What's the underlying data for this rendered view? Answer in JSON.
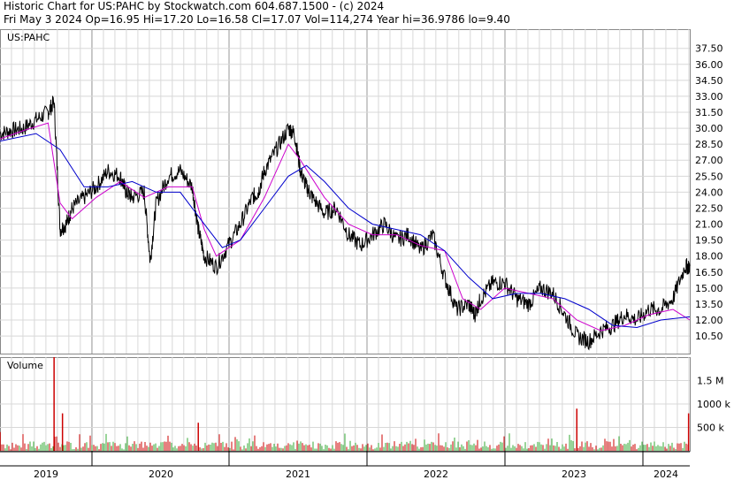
{
  "header": {
    "line1": "Historic Chart for US:PAHC by Stockwatch.com 604.687.1500 - (c) 2024",
    "line2": "Fri May  3 2024   Op=16.95  Hi=17.20  Lo=16.58  Cl=17.07  Vol=114,274  Year hi=36.9786  lo=9.40"
  },
  "chart_data": {
    "type": "line",
    "symbol_label": "US:PAHC",
    "price_ticks": [
      "37.50",
      "36.00",
      "34.50",
      "33.00",
      "31.50",
      "30.00",
      "28.50",
      "27.00",
      "25.50",
      "24.00",
      "22.50",
      "21.00",
      "19.50",
      "18.00",
      "16.50",
      "15.00",
      "13.50",
      "12.00",
      "10.50"
    ],
    "price_tick_values": [
      37.5,
      36.0,
      34.5,
      33.0,
      31.5,
      30.0,
      28.5,
      27.0,
      25.5,
      24.0,
      22.5,
      21.0,
      19.5,
      18.0,
      16.5,
      15.0,
      13.5,
      12.0,
      10.5
    ],
    "ylim": [
      8.85,
      39.3
    ],
    "volume_label": "Volume",
    "volume_ticks": [
      "1.5 M",
      "1000 k",
      "500 k"
    ],
    "volume_tick_values": [
      1500000,
      1000000,
      500000
    ],
    "volume_max": 2000000,
    "year_labels": [
      "2019",
      "2020",
      "2021",
      "2022",
      "2023",
      "2024"
    ],
    "series": [
      {
        "name": "price",
        "color": "#000000",
        "x": [
          2018.6,
          2018.7,
          2018.8,
          2018.9,
          2019.0,
          2019.05,
          2019.1,
          2019.15,
          2019.2,
          2019.3,
          2019.4,
          2019.5,
          2019.6,
          2019.65,
          2019.7,
          2019.8,
          2019.85,
          2019.9,
          2020.0,
          2020.1,
          2020.2,
          2020.25,
          2020.3,
          2020.4,
          2020.5,
          2020.6,
          2020.7,
          2020.75,
          2020.8,
          2020.9,
          2021.0,
          2021.05,
          2021.1,
          2021.15,
          2021.2,
          2021.3,
          2021.4,
          2021.5,
          2021.6,
          2021.7,
          2021.8,
          2021.9,
          2022.0,
          2022.1,
          2022.2,
          2022.3,
          2022.4,
          2022.5,
          2022.55,
          2022.6,
          2022.7,
          2022.8,
          2022.9,
          2023.0,
          2023.1,
          2023.2,
          2023.3,
          2023.4,
          2023.5,
          2023.6,
          2023.7,
          2023.8,
          2023.9,
          2024.0,
          2024.1,
          2024.2,
          2024.3,
          2024.34
        ],
        "y": [
          29.5,
          29.8,
          30.0,
          30.8,
          31.5,
          32.5,
          20.5,
          21.0,
          22.5,
          23.5,
          24.5,
          26.0,
          25.5,
          24.0,
          23.5,
          24.0,
          17.5,
          23.0,
          25.5,
          26.0,
          24.5,
          20.5,
          18.0,
          17.0,
          19.0,
          21.0,
          23.5,
          24.0,
          26.0,
          28.0,
          30.0,
          29.5,
          26.0,
          24.5,
          23.5,
          22.0,
          22.5,
          20.0,
          19.0,
          20.0,
          21.0,
          19.5,
          20.0,
          18.5,
          20.0,
          16.0,
          13.0,
          13.5,
          12.5,
          14.0,
          15.5,
          15.5,
          14.0,
          13.5,
          15.0,
          14.5,
          12.5,
          10.5,
          10.0,
          11.0,
          11.5,
          12.5,
          12.0,
          13.0,
          13.0,
          14.0,
          17.0,
          17.07
        ]
      },
      {
        "name": "short moving average",
        "color": "#cc00cc",
        "x": [
          2018.6,
          2018.8,
          2019.0,
          2019.1,
          2019.2,
          2019.4,
          2019.6,
          2019.8,
          2020.0,
          2020.2,
          2020.3,
          2020.4,
          2020.6,
          2020.8,
          2021.0,
          2021.1,
          2021.3,
          2021.5,
          2021.7,
          2021.9,
          2022.1,
          2022.3,
          2022.45,
          2022.6,
          2022.8,
          2023.0,
          2023.2,
          2023.4,
          2023.6,
          2023.8,
          2024.0,
          2024.2,
          2024.34
        ],
        "y": [
          29.0,
          29.8,
          30.5,
          23.0,
          21.5,
          23.5,
          25.0,
          23.5,
          24.5,
          24.5,
          20.5,
          18.0,
          19.5,
          23.5,
          28.5,
          27.0,
          23.5,
          21.0,
          20.0,
          20.0,
          19.0,
          18.5,
          14.0,
          13.0,
          15.0,
          14.5,
          14.0,
          12.0,
          11.0,
          11.5,
          12.5,
          13.0,
          12.0
        ]
      },
      {
        "name": "long moving average",
        "color": "#0000cc",
        "x": [
          2018.6,
          2018.9,
          2019.1,
          2019.3,
          2019.5,
          2019.7,
          2019.9,
          2020.1,
          2020.3,
          2020.45,
          2020.6,
          2020.8,
          2021.0,
          2021.15,
          2021.3,
          2021.5,
          2021.7,
          2021.9,
          2022.1,
          2022.3,
          2022.5,
          2022.7,
          2022.9,
          2023.1,
          2023.3,
          2023.5,
          2023.7,
          2023.9,
          2024.1,
          2024.34
        ],
        "y": [
          28.8,
          29.5,
          28.0,
          24.5,
          24.5,
          25.0,
          24.0,
          24.0,
          21.0,
          18.8,
          19.5,
          22.5,
          25.5,
          26.5,
          25.0,
          22.5,
          21.0,
          20.5,
          20.0,
          18.5,
          16.0,
          14.0,
          14.5,
          14.5,
          14.0,
          13.0,
          11.5,
          11.3,
          12.0,
          12.3
        ]
      }
    ],
    "volume": {
      "baseline_range_k": [
        30,
        250
      ],
      "spikes": [
        {
          "x": 2018.6,
          "value": 400000
        },
        {
          "x": 2019.05,
          "value": 2000000
        },
        {
          "x": 2019.12,
          "value": 800000
        },
        {
          "x": 2020.25,
          "value": 600000
        },
        {
          "x": 2023.4,
          "value": 900000
        },
        {
          "x": 2024.33,
          "value": 800000
        }
      ]
    }
  }
}
